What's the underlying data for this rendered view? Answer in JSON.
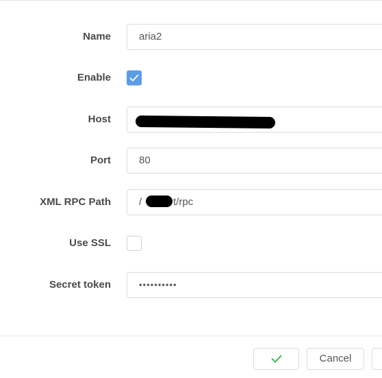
{
  "form": {
    "name": {
      "label": "Name",
      "value": "aria2"
    },
    "enable": {
      "label": "Enable",
      "checked": true
    },
    "host": {
      "label": "Host",
      "value": ""
    },
    "port": {
      "label": "Port",
      "value": "80"
    },
    "xml_rpc_path": {
      "label": "XML RPC Path",
      "prefix": "/",
      "suffix": "t/rpc"
    },
    "use_ssl": {
      "label": "Use SSL",
      "checked": false
    },
    "secret_token": {
      "label": "Secret token",
      "value": "••••••••••"
    }
  },
  "footer": {
    "cancel_label": "Cancel"
  },
  "icons": {
    "ok": "check-icon",
    "enable": "check-icon"
  },
  "colors": {
    "checkbox_checked": "#5b9ce6",
    "ok_check": "#2fb344"
  }
}
